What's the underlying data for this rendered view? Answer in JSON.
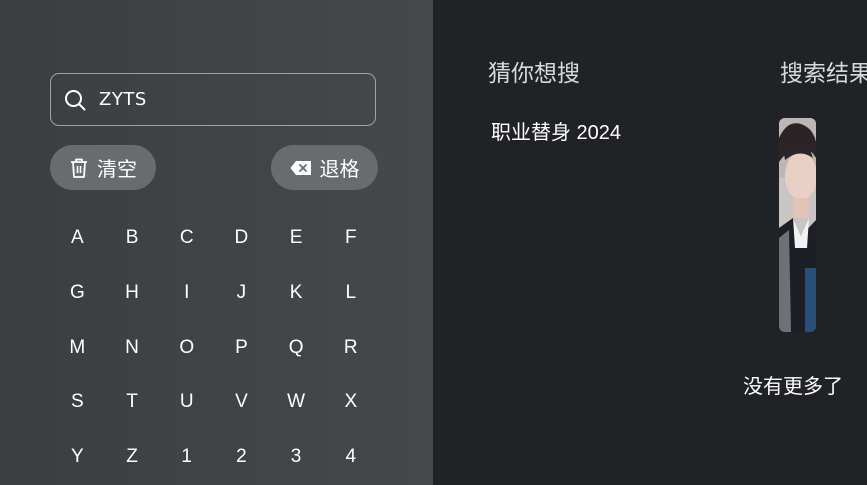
{
  "search": {
    "value": "ZYTS"
  },
  "buttons": {
    "clear_label": "清空",
    "backspace_label": "退格"
  },
  "keyboard": {
    "keys": [
      "A",
      "B",
      "C",
      "D",
      "E",
      "F",
      "G",
      "H",
      "I",
      "J",
      "K",
      "L",
      "M",
      "N",
      "O",
      "P",
      "Q",
      "R",
      "S",
      "T",
      "U",
      "V",
      "W",
      "X",
      "Y",
      "Z",
      "1",
      "2",
      "3",
      "4"
    ]
  },
  "suggestions": {
    "title": "猜你想搜",
    "items": [
      "职业替身 2024"
    ]
  },
  "results": {
    "title": "搜索结果",
    "footer": "没有更多了"
  },
  "colors": {
    "left_panel": "#424547",
    "right_panel": "#202225",
    "pill": "#696c6e"
  }
}
